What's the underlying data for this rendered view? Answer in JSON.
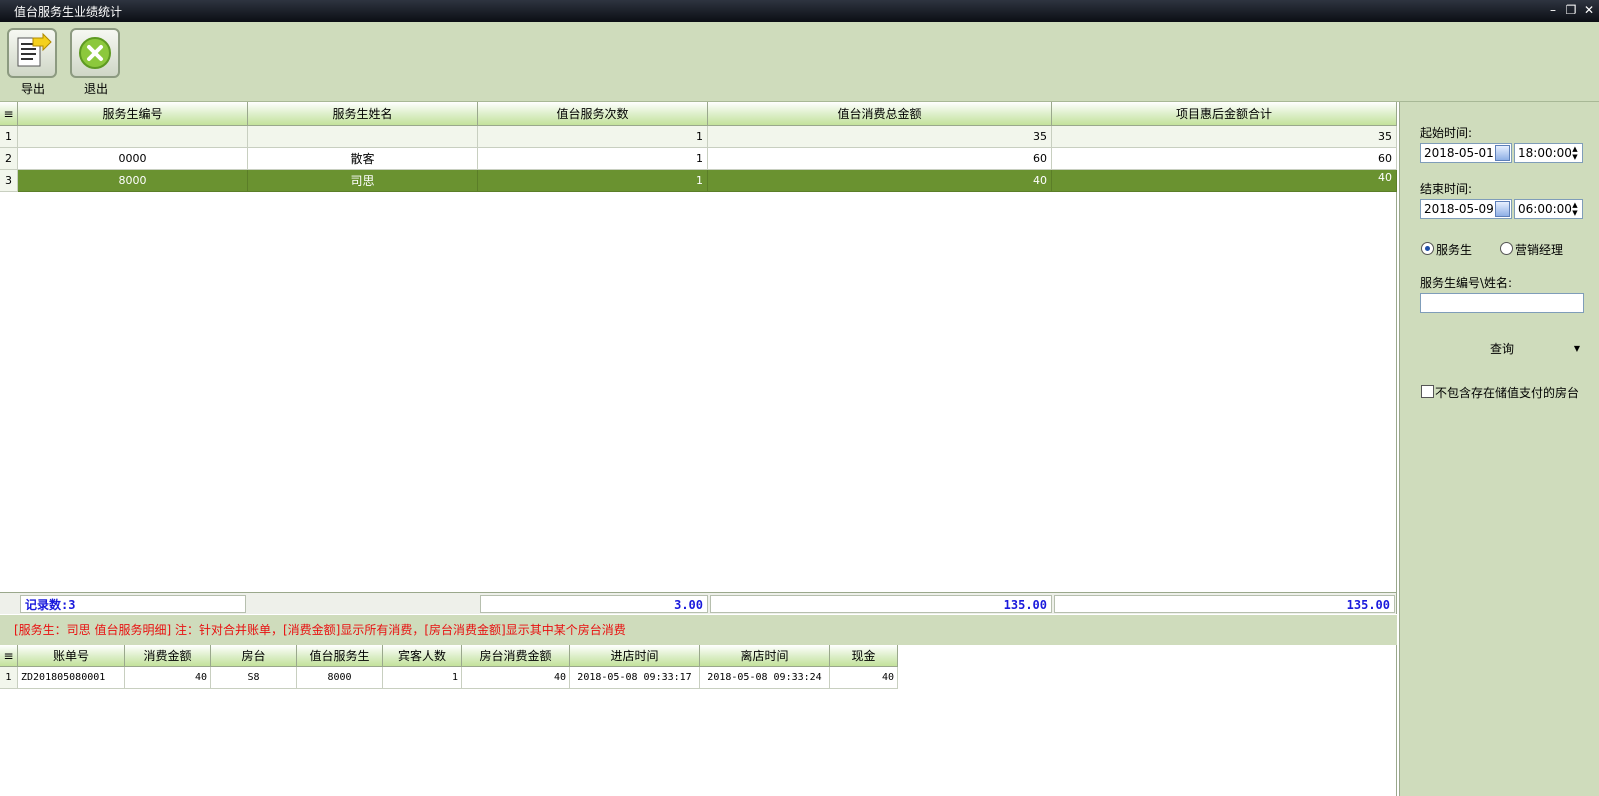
{
  "window": {
    "title": "值台服务生业绩统计"
  },
  "toolbar": {
    "export_label": "导出",
    "exit_label": "退出"
  },
  "grid": {
    "headers": [
      "服务生编号",
      "服务生姓名",
      "值台服务次数",
      "值台消费总金额",
      "项目惠后金额合计"
    ],
    "rows": [
      {
        "no": "1",
        "id": "",
        "name": "",
        "count": "1",
        "total": "35",
        "after": "35"
      },
      {
        "no": "2",
        "id": "0000",
        "name": "散客",
        "count": "1",
        "total": "60",
        "after": "60"
      },
      {
        "no": "3",
        "id": "8000",
        "name": "司思",
        "count": "1",
        "total": "40",
        "after": "40"
      }
    ],
    "selected_row": 3
  },
  "summary": {
    "record_label": "记录数:3",
    "count_total": "3.00",
    "total_sum": "135.00",
    "after_sum": "135.00"
  },
  "note": {
    "text": "[服务生：司思 值台服务明细]    注：针对合并账单，[消费金额]显示所有消费，[房台消费金额]显示其中某个房台消费"
  },
  "detail": {
    "headers": [
      "账单号",
      "消费金额",
      "房台",
      "值台服务生",
      "宾客人数",
      "房台消费金额",
      "进店时间",
      "离店时间",
      "现金"
    ],
    "rows": [
      {
        "no": "1",
        "bill": "ZD201805080001",
        "amount": "40",
        "room": "S8",
        "waiter": "8000",
        "guests": "1",
        "room_amount": "40",
        "in_time": "2018-05-08 09:33:17",
        "out_time": "2018-05-08 09:33:24",
        "cash": "40"
      }
    ]
  },
  "side": {
    "start_label": "起始时间:",
    "start_date": "2018-05-01",
    "start_time": "18:00:00",
    "end_label": "结束时间:",
    "end_date": "2018-05-09",
    "end_time": "06:00:00",
    "radio_waiter": "服务生",
    "radio_manager": "营销经理",
    "selected_radio": "服务生",
    "id_name_label": "服务生编号\\姓名:",
    "id_name_value": "",
    "query_label": "查询",
    "exclude_label": "不包含存在储值支付的房台"
  },
  "colors": {
    "selected_row": "#6a9230",
    "panel_bg": "#cfdcbc",
    "note_text": "#e81010",
    "summary_text": "#1a1adc"
  }
}
